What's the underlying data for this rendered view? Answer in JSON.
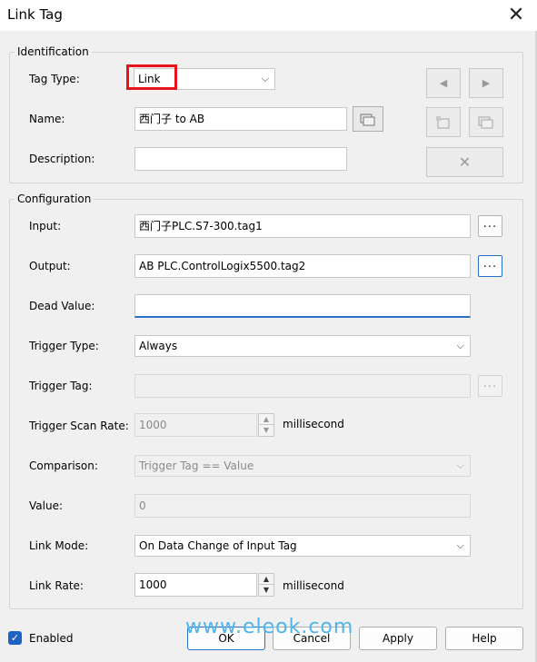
{
  "window": {
    "title": "Link Tag",
    "close_glyph": "✕"
  },
  "identification": {
    "group_title": "Identification",
    "tag_type_label": "Tag Type:",
    "tag_type_value": "Link",
    "name_label": "Name:",
    "name_value": "西门子 to AB",
    "description_label": "Description:",
    "description_value": "",
    "nav_prev_glyph": "◀",
    "nav_next_glyph": "▶",
    "delete_glyph": "✕"
  },
  "configuration": {
    "group_title": "Configuration",
    "input_label": "Input:",
    "input_value": "西门子PLC.S7-300.tag1",
    "output_label": "Output:",
    "output_value": "AB PLC.ControlLogix5500.tag2",
    "dead_value_label": "Dead Value:",
    "dead_value_value": "",
    "trigger_type_label": "Trigger Type:",
    "trigger_type_value": "Always",
    "trigger_tag_label": "Trigger Tag:",
    "trigger_tag_value": "",
    "trigger_scan_rate_label": "Trigger Scan Rate:",
    "trigger_scan_rate_value": "1000",
    "trigger_scan_rate_unit": "milliseconds",
    "comparison_label": "Comparison:",
    "comparison_value": "Trigger Tag == Value",
    "value_label": "Value:",
    "value_value": "0",
    "link_mode_label": "Link Mode:",
    "link_mode_value": "On Data Change of Input Tag",
    "link_rate_label": "Link Rate:",
    "link_rate_value": "1000",
    "link_rate_unit": "milliseconds",
    "ellipsis": "...",
    "combo_arrow": "⌵"
  },
  "footer": {
    "enabled_label": "Enabled",
    "enabled_checked": true,
    "ok_label": "OK",
    "cancel_label": "Cancel",
    "apply_label": "Apply",
    "help_label": "Help"
  },
  "watermark": "www.eleok.com",
  "colors": {
    "accent": "#2a6fc7",
    "highlight": "#e8141c",
    "watermark": "#4fb4ec"
  }
}
